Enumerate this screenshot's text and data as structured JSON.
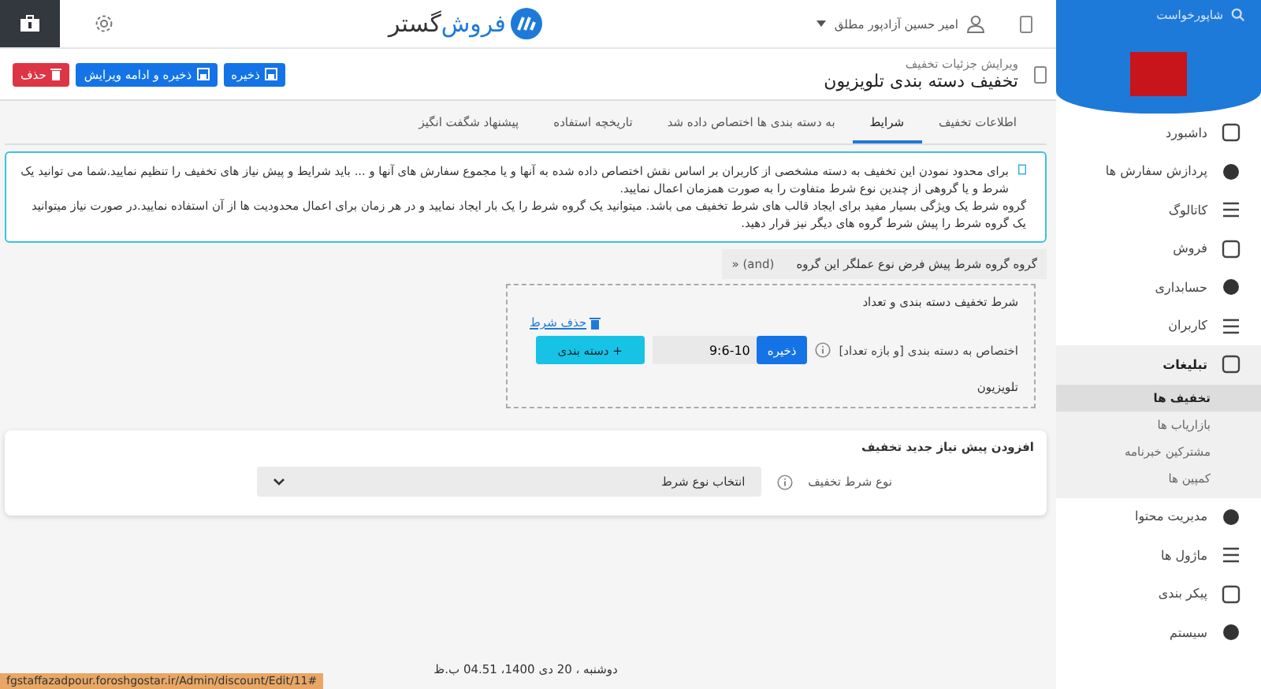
{
  "sidebar": {
    "search": "شاپورخواست",
    "menu": [
      {
        "label": "داشبورد",
        "expanded": false
      },
      {
        "label": "پردازش سفارش ها",
        "expanded": false
      },
      {
        "label": "کاتالوگ",
        "expanded": false
      },
      {
        "label": "فروش",
        "expanded": false
      },
      {
        "label": "حسابداری",
        "expanded": false
      },
      {
        "label": "کاربران",
        "expanded": false
      },
      {
        "label": "تبلیغات",
        "expanded": true,
        "children": [
          {
            "label": "تخفیف ها",
            "selected": true
          },
          {
            "label": "بازاریاب ها",
            "selected": false
          },
          {
            "label": "مشترکین خبرنامه",
            "selected": false
          },
          {
            "label": "کمپین ها",
            "selected": false
          }
        ]
      },
      {
        "label": "مدیریت محتوا",
        "expanded": false
      },
      {
        "label": "ماژول ها",
        "expanded": false
      },
      {
        "label": "پیکر بندی",
        "expanded": false
      },
      {
        "label": "سیستم",
        "expanded": false
      }
    ]
  },
  "header": {
    "user": "امیر حسین آزادپور مطلق",
    "logo_primary": "فروش",
    "logo_secondary": "گستر"
  },
  "title_bar": {
    "breadcrumb": "ویرایش جزئیات تخفیف",
    "title": "تخفیف دسته بندی تلویزیون",
    "buttons": [
      {
        "label": "ذخیره",
        "kind": "save"
      },
      {
        "label": "ذخیره و ادامه ویرایش",
        "kind": "save-continue"
      },
      {
        "label": "حذف",
        "kind": "delete"
      }
    ]
  },
  "tabs": [
    {
      "label": "اطلاعات تخفیف",
      "selected": false
    },
    {
      "label": "شرایط",
      "selected": true
    },
    {
      "label": "به دسته بندی ها اختصاص داده شد",
      "selected": false
    },
    {
      "label": "تاریخچه استفاده",
      "selected": false
    },
    {
      "label": "پیشنهاد شگفت انگیز",
      "selected": false
    }
  ],
  "info": [
    "برای محدود نمودن این تخفیف به دسته مشخصی از کاربران بر اساس نقش اختصاص داده شده به آنها و یا مجموع سفارش های آنها و ... باید شرایط و پیش نیاز های تخفیف را تنظیم نمایید.شما می توانید یک شرط و یا گروهی از چندین نوع شرط متفاوت را به صورت همزمان اعمال نمایید.",
    "گروه شرط یک ویژگی بسیار مفید برای ایجاد قالب های شرط تخفیف می باشد. میتوانید یک گروه شرط را یک بار ایجاد نمایید و در هر زمان برای اعمال محدودیت ها از آن استفاده نمایید.در صورت نیاز میتوانید یک گروه شرط را پیش شرط گروه های دیگر نیز قرار دهید."
  ],
  "group": {
    "label": "گروه گروه شرط پیش فرض نوع عملگر این گروه",
    "operator": "» (and)",
    "condition": {
      "title": "شرط تخفیف دسته بندی و تعداد",
      "delete_link": "حذف شرط",
      "field_label": "اختصاص به دسته بندی [و بازه تعداد]",
      "save_button": "ذخیره",
      "value": "9:6-10",
      "add_button": "+ دسته بندی",
      "category": "تلویزیون"
    }
  },
  "new_requirement": {
    "title": "افزودن پیش نیاز جدید تخفیف",
    "label": "نوع شرط تخفیف",
    "select": "انتخاب نوع شرط"
  },
  "footer": "دوشنبه ، 20 دی 1400، 04.51 ب.ظ",
  "status_url": "fgstaffazadpour.foroshgostar.ir/Admin/discount/Edit/11#"
}
